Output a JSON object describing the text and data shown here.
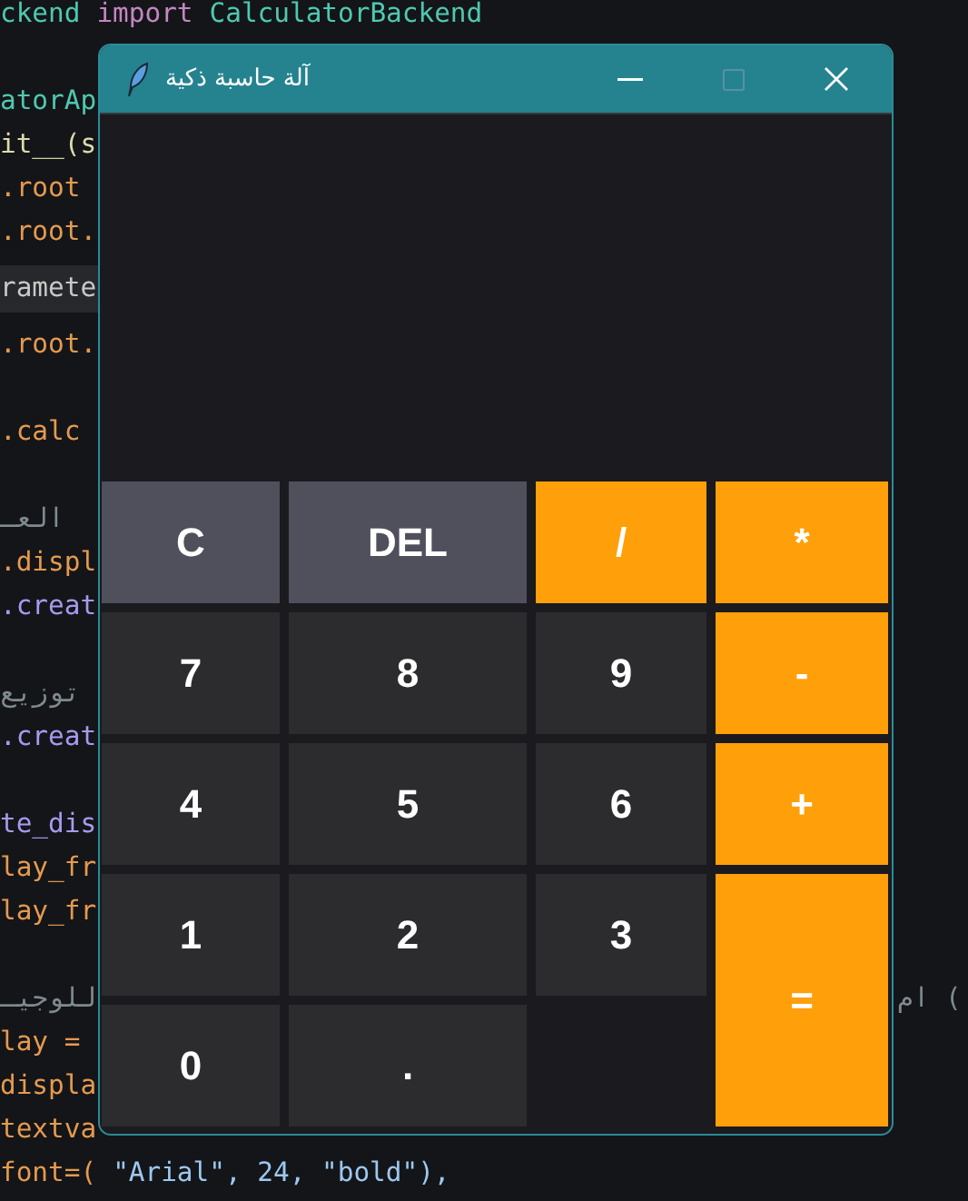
{
  "editor": {
    "lines": [
      {
        "kind": "code",
        "segments": [
          {
            "text": "ckend",
            "color": "#4ec9b0"
          },
          {
            "text": "import",
            "color": "#c586c0"
          },
          {
            "text": "CalculatorBackend",
            "color": "#4ec9b0"
          }
        ]
      },
      {
        "kind": "code",
        "spaced": true,
        "segments": [
          {
            "text": "atorAp",
            "color": "#4ec9b0"
          }
        ]
      },
      {
        "kind": "code",
        "segments": [
          {
            "text": "it__(s",
            "color": "#dcdcaa"
          }
        ]
      },
      {
        "kind": "code",
        "segments": [
          {
            "text": ".root",
            "color": "#e59a4e"
          }
        ]
      },
      {
        "kind": "code",
        "segments": [
          {
            "text": ".root.",
            "color": "#e59a4e"
          }
        ]
      },
      {
        "kind": "tooltip",
        "segments": [
          {
            "text": "ramete",
            "color": "#c8c8c8"
          }
        ]
      },
      {
        "kind": "code",
        "segments": [
          {
            "text": ".root.",
            "color": "#e59a4e"
          }
        ]
      },
      {
        "kind": "code",
        "spaced": true,
        "segments": [
          {
            "text": ".calc",
            "color": "#e59a4e"
          }
        ]
      },
      {
        "kind": "code",
        "spaced": true,
        "segments": [
          {
            "text": "العـ",
            "color": "#7f8a8f"
          }
        ]
      },
      {
        "kind": "code",
        "segments": [
          {
            "text": ".displ",
            "color": "#e59a4e"
          }
        ]
      },
      {
        "kind": "code",
        "segments": [
          {
            "text": ".creat",
            "color": "#a59bf0"
          }
        ]
      },
      {
        "kind": "code",
        "spaced": true,
        "segments": [
          {
            "text": "توزيع",
            "color": "#7f8a8f"
          }
        ]
      },
      {
        "kind": "code",
        "segments": [
          {
            "text": ".creat",
            "color": "#a59bf0"
          }
        ]
      },
      {
        "kind": "code",
        "spaced": true,
        "segments": [
          {
            "text": "te_dis",
            "color": "#a59bf0"
          }
        ]
      },
      {
        "kind": "code",
        "segments": [
          {
            "text": "lay_fr",
            "color": "#e59a4e"
          }
        ]
      },
      {
        "kind": "code",
        "segments": [
          {
            "text": "lay_fr",
            "color": "#e59a4e"
          }
        ]
      },
      {
        "kind": "code",
        "spaced": true,
        "segments": [
          {
            "text": "للوجيـ",
            "color": "#7f8a8f"
          }
        ],
        "trailing": "ام ("
      },
      {
        "kind": "code",
        "segments": [
          {
            "text": "lay =",
            "color": "#e59a4e"
          }
        ]
      },
      {
        "kind": "code",
        "segments": [
          {
            "text": "displa",
            "color": "#e59a4e"
          }
        ]
      },
      {
        "kind": "code",
        "segments": [
          {
            "text": "textva",
            "color": "#e59a4e"
          }
        ]
      },
      {
        "kind": "code",
        "segments": [
          {
            "text": "font=(",
            "color": "#e59a4e"
          },
          {
            "text": "\"Arial\", 24, \"bold\"),",
            "color": "#9cc8f0"
          }
        ]
      }
    ]
  },
  "window": {
    "title": "آلة حاسبة ذكية",
    "maximize_disabled": true
  },
  "buttons": [
    {
      "label": "C",
      "kind": "control"
    },
    {
      "label": "DEL",
      "kind": "control"
    },
    {
      "label": "/",
      "kind": "operator"
    },
    {
      "label": "*",
      "kind": "operator"
    },
    {
      "label": "7",
      "kind": "digit"
    },
    {
      "label": "8",
      "kind": "digit"
    },
    {
      "label": "9",
      "kind": "digit"
    },
    {
      "label": "-",
      "kind": "operator"
    },
    {
      "label": "4",
      "kind": "digit"
    },
    {
      "label": "5",
      "kind": "digit"
    },
    {
      "label": "6",
      "kind": "digit"
    },
    {
      "label": "+",
      "kind": "operator"
    },
    {
      "label": "1",
      "kind": "digit"
    },
    {
      "label": "2",
      "kind": "digit"
    },
    {
      "label": "3",
      "kind": "digit"
    },
    {
      "label": "=",
      "kind": "equals"
    },
    {
      "label": "0",
      "kind": "digit"
    },
    {
      "label": ".",
      "kind": "digit"
    }
  ]
}
